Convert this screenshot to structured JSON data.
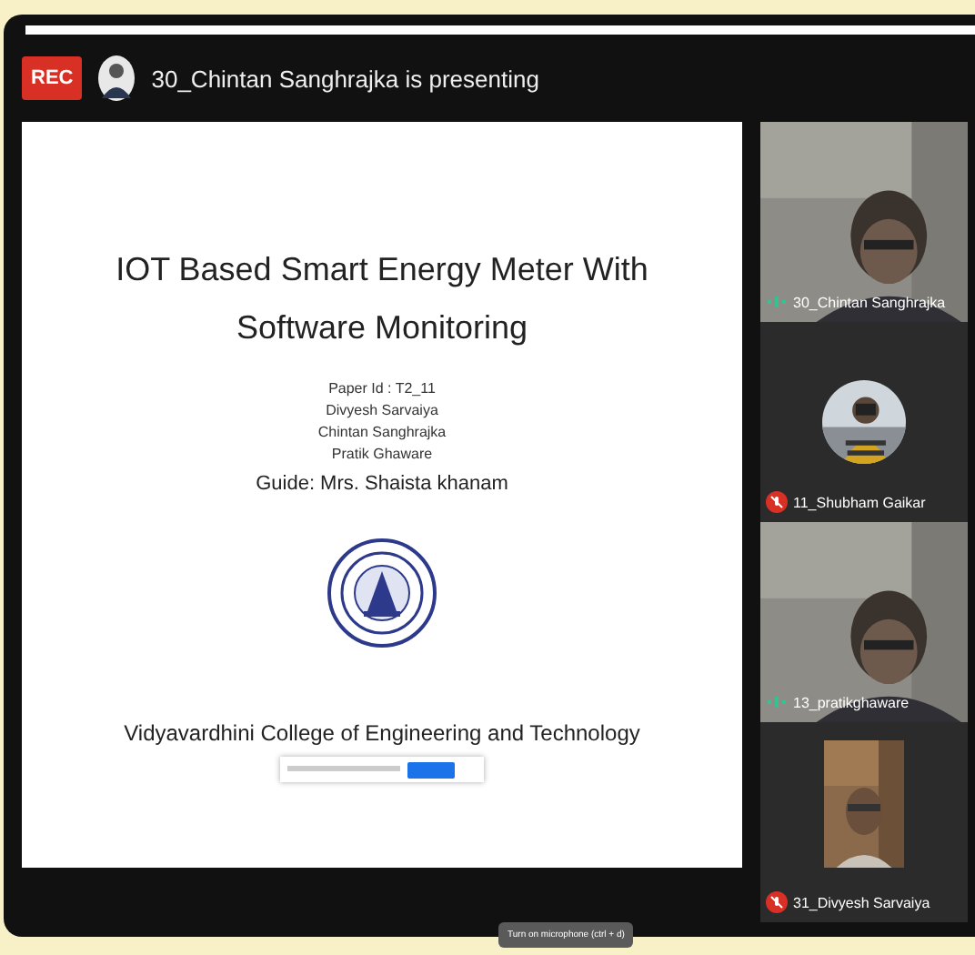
{
  "recording": {
    "label": "REC"
  },
  "presenter_banner": {
    "text": "30_Chintan Sanghrajka is presenting"
  },
  "slide": {
    "title": "IOT Based Smart Energy Meter With Software Monitoring",
    "details": [
      "Paper Id : T2_11",
      "Divyesh Sarvaiya",
      "Chintan Sanghrajka",
      "Pratik Ghaware"
    ],
    "guide": "Guide: Mrs. Shaista khanam",
    "college": "Vidyavardhini College of Engineering and Technology"
  },
  "participants": [
    {
      "name": "30_Chintan Sanghrajka",
      "kind": "video",
      "muted": false
    },
    {
      "name": "11_Shubham Gaikar",
      "kind": "avatar",
      "muted": true
    },
    {
      "name": "13_pratikghaware",
      "kind": "video",
      "muted": false
    },
    {
      "name": "31_Divyesh Sarvaiya",
      "kind": "inset",
      "muted": true
    }
  ],
  "tooltip": {
    "text": "Turn on microphone (ctrl + d)"
  }
}
